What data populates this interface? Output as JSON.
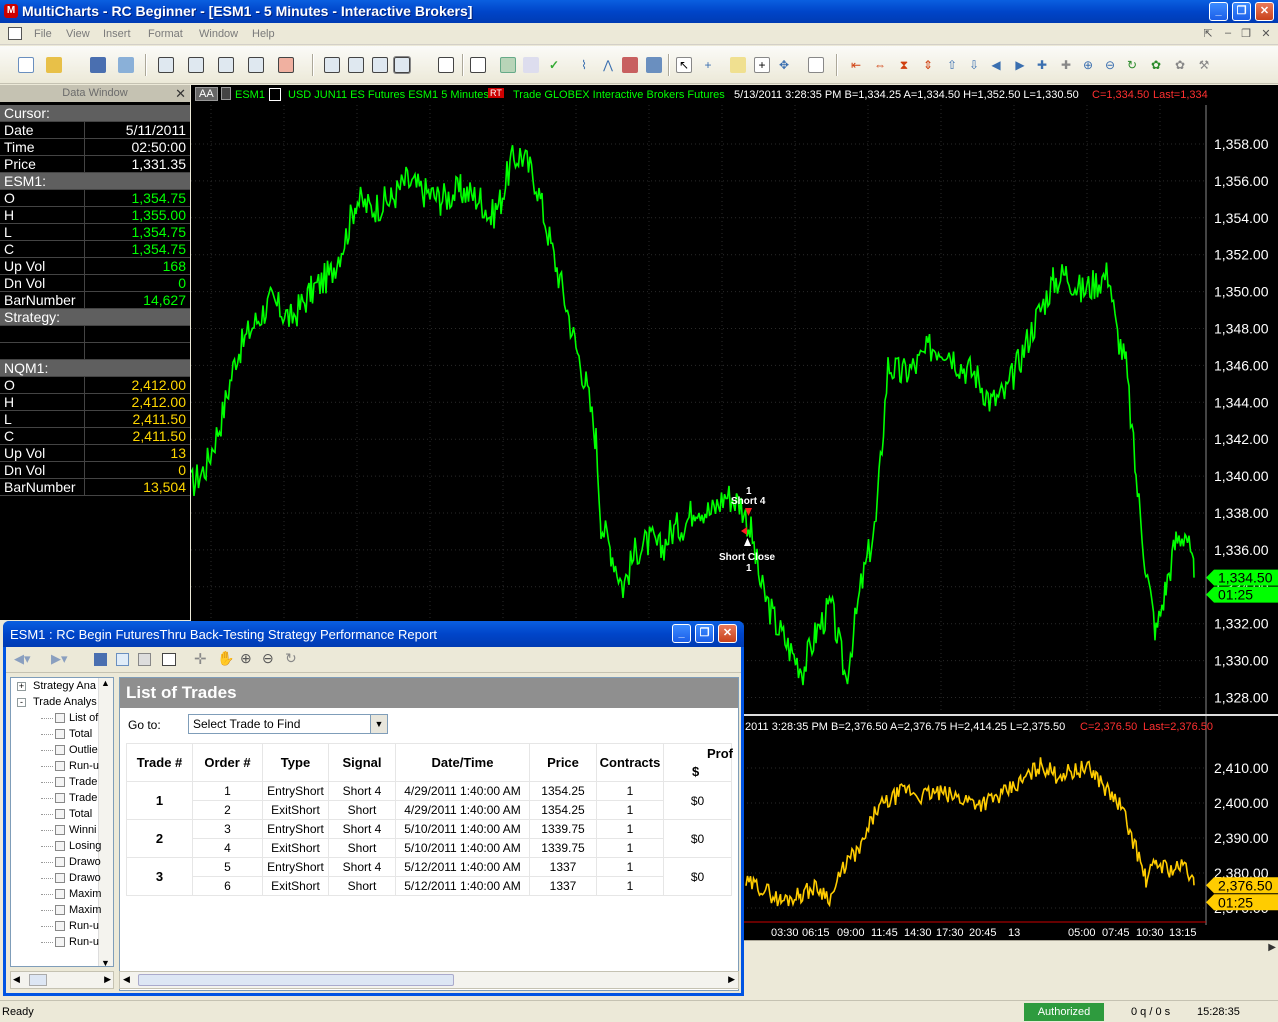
{
  "window": {
    "title": "MultiCharts - RC Beginner - [ESM1 - 5 Minutes - Interactive Brokers]"
  },
  "menu": [
    "File",
    "View",
    "Insert",
    "Format",
    "Window",
    "Help"
  ],
  "data_window": {
    "title": "Data Window",
    "rows": [
      {
        "k": "Cursor:",
        "v": "",
        "sec": true
      },
      {
        "k": "Date",
        "v": "5/11/2011",
        "color": "#ffffff"
      },
      {
        "k": "Time",
        "v": "02:50:00",
        "color": "#ffffff"
      },
      {
        "k": "Price",
        "v": "1,331.35",
        "color": "#ffffff"
      },
      {
        "k": "ESM1:",
        "v": "",
        "sec": true
      },
      {
        "k": "O",
        "v": "1,354.75",
        "color": "#00ff00"
      },
      {
        "k": "H",
        "v": "1,355.00",
        "color": "#00ff00"
      },
      {
        "k": "L",
        "v": "1,354.75",
        "color": "#00ff00"
      },
      {
        "k": "C",
        "v": "1,354.75",
        "color": "#00ff00"
      },
      {
        "k": "Up Vol",
        "v": "168",
        "color": "#00ff00"
      },
      {
        "k": "Dn Vol",
        "v": "0",
        "color": "#00ff00"
      },
      {
        "k": "BarNumber",
        "v": "14,627",
        "color": "#00ff00"
      },
      {
        "k": "Strategy:",
        "v": "",
        "sec": true
      },
      {
        "k": "",
        "v": "",
        "color": "#ffffff"
      },
      {
        "k": "",
        "v": "",
        "color": "#ffffff"
      },
      {
        "k": "NQM1:",
        "v": "",
        "sec": true
      },
      {
        "k": "O",
        "v": "2,412.00",
        "color": "#ffd700"
      },
      {
        "k": "H",
        "v": "2,412.00",
        "color": "#ffd700"
      },
      {
        "k": "L",
        "v": "2,411.50",
        "color": "#ffd700"
      },
      {
        "k": "C",
        "v": "2,411.50",
        "color": "#ffd700"
      },
      {
        "k": "Up Vol",
        "v": "13",
        "color": "#ffd700"
      },
      {
        "k": "Dn Vol",
        "v": "0",
        "color": "#ffd700"
      },
      {
        "k": "BarNumber",
        "v": "13,504",
        "color": "#ffd700"
      }
    ]
  },
  "chart": {
    "status_top": {
      "aa": "AA",
      "symbol": "ESM1",
      "desc": "USD JUN11 ES Futures ESM1  5 Minutes",
      "badge": "RT",
      "trade": "Trade  GLOBEX  Interactive Brokers  Futures",
      "quote": "5/13/2011  3:28:35 PM  B=1,334.25  A=1,334.50  H=1,352.50  L=1,330.50",
      "close": "C=1,334.50",
      "last": "Last=1,334"
    },
    "status_bottom": {
      "quote": "2011  3:28:35 PM  B=2,376.50  A=2,376.75  H=2,414.25  L=2,375.50",
      "close": "C=2,376.50",
      "last": "Last=2,376.50"
    },
    "upper_axis": [
      "1,358.00",
      "1,356.00",
      "1,354.00",
      "1,352.00",
      "1,350.00",
      "1,348.00",
      "1,346.00",
      "1,344.00",
      "1,342.00",
      "1,340.00",
      "1,338.00",
      "1,336.00",
      "1,334.00",
      "1,332.00",
      "1,330.00",
      "1,328.00"
    ],
    "upper_last": "1,334.50",
    "upper_timer": "01:25",
    "lower_axis": [
      "2,410.00",
      "2,400.00",
      "2,390.00",
      "2,380.00",
      "2,370.00"
    ],
    "lower_last": "2,376.50",
    "lower_timer": "01:25",
    "time_axis": [
      "03:30",
      "06:15",
      "09:00",
      "11:45",
      "14:30",
      "17:30",
      "20:45",
      "13",
      "05:00",
      "07:45",
      "10:30",
      "13:15"
    ],
    "markers": {
      "entry_num": "1",
      "entry": "Short 4",
      "exit": "Short Close",
      "exit_num": "1"
    },
    "colors": {
      "upper": "#00ff00",
      "lower": "#ffcc00"
    }
  },
  "report": {
    "title": "ESM1 : RC Begin FuturesThru Back-Testing Strategy Performance Report",
    "tree": [
      {
        "label": "Strategy Ana",
        "level": 0,
        "exp": "+"
      },
      {
        "label": "Trade Analys",
        "level": 0,
        "exp": "-"
      },
      {
        "label": "List of",
        "level": 1
      },
      {
        "label": "Total",
        "level": 1
      },
      {
        "label": "Outlie",
        "level": 1
      },
      {
        "label": "Run-u",
        "level": 1
      },
      {
        "label": "Trade",
        "level": 1
      },
      {
        "label": "Trade",
        "level": 1
      },
      {
        "label": "Total",
        "level": 1
      },
      {
        "label": "Winni",
        "level": 1
      },
      {
        "label": "Losing",
        "level": 1
      },
      {
        "label": "Drawo",
        "level": 1
      },
      {
        "label": "Drawo",
        "level": 1
      },
      {
        "label": "Maxim",
        "level": 1
      },
      {
        "label": "Maxim",
        "level": 1
      },
      {
        "label": "Run-u",
        "level": 1
      },
      {
        "label": "Run-u",
        "level": 1
      }
    ],
    "heading": "List of Trades",
    "goto_label": "Go to:",
    "goto_value": "Select Trade to Find",
    "columns": [
      "Trade #",
      "Order #",
      "Type",
      "Signal",
      "Date/Time",
      "Price",
      "Contracts",
      "Prof"
    ],
    "profit_sub": "$",
    "trades": [
      {
        "trade": "1",
        "profit": "$0",
        "orders": [
          {
            "order": "1",
            "type": "EntryShort",
            "signal": "Short 4",
            "dt": "4/29/2011 1:40:00 AM",
            "price": "1354.25",
            "contracts": "1"
          },
          {
            "order": "2",
            "type": "ExitShort",
            "signal": "Short",
            "dt": "4/29/2011 1:40:00 AM",
            "price": "1354.25",
            "contracts": "1"
          }
        ]
      },
      {
        "trade": "2",
        "profit": "$0",
        "orders": [
          {
            "order": "3",
            "type": "EntryShort",
            "signal": "Short 4",
            "dt": "5/10/2011 1:40:00 AM",
            "price": "1339.75",
            "contracts": "1"
          },
          {
            "order": "4",
            "type": "ExitShort",
            "signal": "Short",
            "dt": "5/10/2011 1:40:00 AM",
            "price": "1339.75",
            "contracts": "1"
          }
        ]
      },
      {
        "trade": "3",
        "profit": "$0",
        "orders": [
          {
            "order": "5",
            "type": "EntryShort",
            "signal": "Short 4",
            "dt": "5/12/2011 1:40:00 AM",
            "price": "1337",
            "contracts": "1"
          },
          {
            "order": "6",
            "type": "ExitShort",
            "signal": "Short",
            "dt": "5/12/2011 1:40:00 AM",
            "price": "1337",
            "contracts": "1"
          }
        ]
      }
    ]
  },
  "statusbar": {
    "ready": "Ready",
    "authorized": "Authorized",
    "queue": "0 q / 0 s",
    "clock": "15:28:35"
  }
}
